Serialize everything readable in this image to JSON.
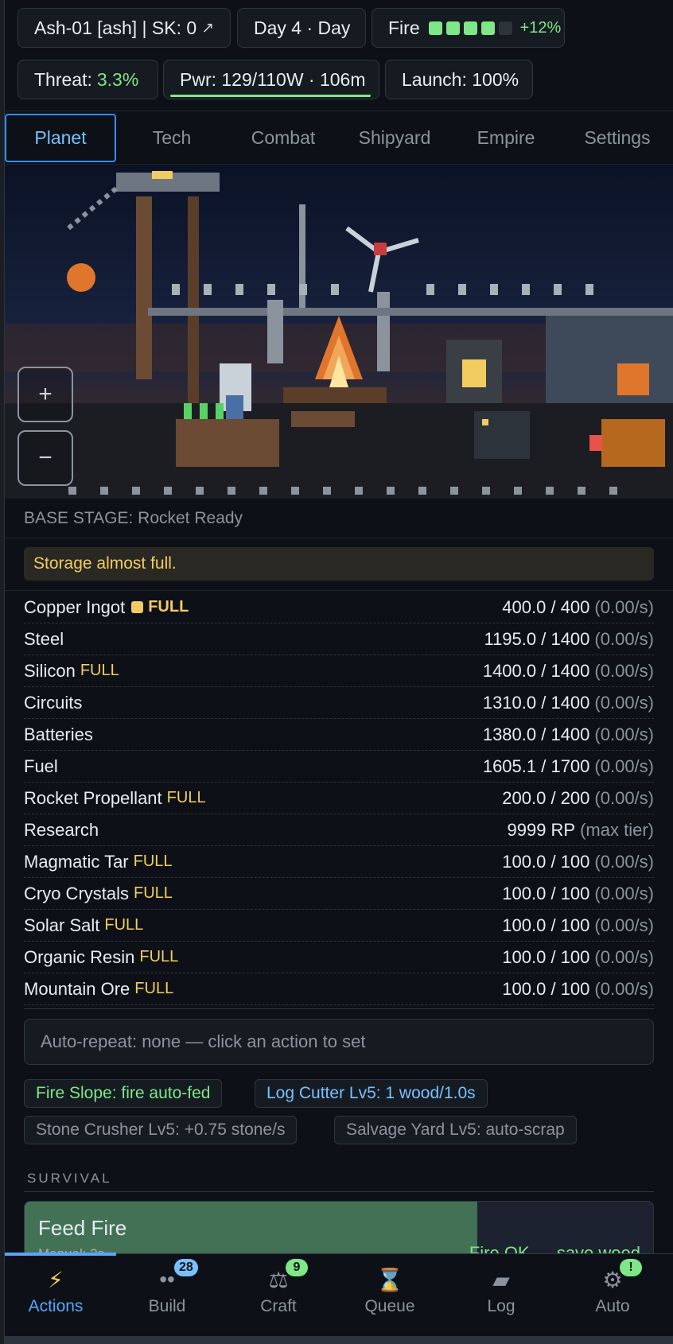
{
  "header": {
    "base_label": "Ash-01 [ash] | SK: 0",
    "day_label": "Day 4 · Day",
    "fire_label": "Fire",
    "fire_segments_filled": 4,
    "fire_segments_total": 5,
    "fire_boost": "+12%",
    "threat_label": "Threat:",
    "threat_value": "3.3%",
    "power_label": "Pwr: 129/110W · 106m",
    "power_fill_percent": 100,
    "launch_label": "Launch: 100%"
  },
  "tabs": [
    {
      "label": "Planet",
      "active": true
    },
    {
      "label": "Tech",
      "active": false
    },
    {
      "label": "Combat",
      "active": false
    },
    {
      "label": "Shipyard",
      "active": false
    },
    {
      "label": "Empire",
      "active": false
    },
    {
      "label": "Settings",
      "active": false
    }
  ],
  "scene": {
    "zoom_in": "+",
    "zoom_out": "−"
  },
  "base_stage": "BASE STAGE: Rocket Ready",
  "warning": "Storage almost full.",
  "resources": [
    {
      "name": "Copper Ingot",
      "chip": true,
      "full": "FULL",
      "bold": true,
      "amount": "400.0 / 400",
      "rate": "(0.00/s)"
    },
    {
      "name": "Steel",
      "chip": false,
      "full": "",
      "bold": false,
      "amount": "1195.0 / 1400",
      "rate": "(0.00/s)"
    },
    {
      "name": "Silicon",
      "chip": false,
      "full": "FULL",
      "bold": false,
      "amount": "1400.0 / 1400",
      "rate": "(0.00/s)"
    },
    {
      "name": "Circuits",
      "chip": false,
      "full": "",
      "bold": false,
      "amount": "1310.0 / 1400",
      "rate": "(0.00/s)"
    },
    {
      "name": "Batteries",
      "chip": false,
      "full": "",
      "bold": false,
      "amount": "1380.0 / 1400",
      "rate": "(0.00/s)"
    },
    {
      "name": "Fuel",
      "chip": false,
      "full": "",
      "bold": false,
      "amount": "1605.1 / 1700",
      "rate": "(0.00/s)"
    },
    {
      "name": "Rocket Propellant",
      "chip": false,
      "full": "FULL",
      "bold": false,
      "amount": "200.0 / 200",
      "rate": "(0.00/s)"
    },
    {
      "name": "Research",
      "chip": false,
      "full": "",
      "bold": false,
      "amount": "9999 RP",
      "rate": "(max tier)"
    },
    {
      "name": "Magmatic Tar",
      "chip": false,
      "full": "FULL",
      "bold": false,
      "amount": "100.0 / 100",
      "rate": "(0.00/s)"
    },
    {
      "name": "Cryo Crystals",
      "chip": false,
      "full": "FULL",
      "bold": false,
      "amount": "100.0 / 100",
      "rate": "(0.00/s)"
    },
    {
      "name": "Solar Salt",
      "chip": false,
      "full": "FULL",
      "bold": false,
      "amount": "100.0 / 100",
      "rate": "(0.00/s)"
    },
    {
      "name": "Organic Resin",
      "chip": false,
      "full": "FULL",
      "bold": false,
      "amount": "100.0 / 100",
      "rate": "(0.00/s)"
    },
    {
      "name": "Mountain Ore",
      "chip": false,
      "full": "FULL",
      "bold": false,
      "amount": "100.0 / 100",
      "rate": "(0.00/s)"
    }
  ],
  "auto_repeat": "Auto-repeat: none — click an action to set",
  "automation_tags": [
    {
      "label": "Fire Slope: fire auto-fed",
      "tone": "green"
    },
    {
      "label": "Log Cutter Lv5: 1 wood/1.0s",
      "tone": "blue"
    },
    {
      "label": "Stone Crusher Lv5: +0.75 stone/s",
      "tone": "grey"
    },
    {
      "label": "Salvage Yard Lv5: auto-scrap",
      "tone": "grey"
    }
  ],
  "section_label": "SURVIVAL",
  "action_card": {
    "title": "Feed Fire",
    "subtitle": "Manual: 2s",
    "status": "Fire OK — save wood",
    "progress_percent": 72
  },
  "bottom_nav": [
    {
      "label": "Actions",
      "icon": "lightning-icon",
      "glyph": "⚡",
      "badge": "",
      "active": true
    },
    {
      "label": "Build",
      "icon": "build-icon",
      "glyph": "••",
      "badge": "28",
      "badge_tone": "blue",
      "active": false
    },
    {
      "label": "Craft",
      "icon": "scales-icon",
      "glyph": "⚖",
      "badge": "9",
      "badge_tone": "green",
      "active": false
    },
    {
      "label": "Queue",
      "icon": "hourglass-icon",
      "glyph": "⌛",
      "badge": "",
      "active": false
    },
    {
      "label": "Log",
      "icon": "log-icon",
      "glyph": "▰",
      "badge": "",
      "active": false
    },
    {
      "label": "Auto",
      "icon": "gear-icon",
      "glyph": "⚙",
      "badge": "!",
      "badge_tone": "green",
      "active": false
    }
  ],
  "colors": {
    "accent": "#58a6ff",
    "good": "#7ee787",
    "warn": "#f2cc60",
    "background": "#0d1117"
  }
}
